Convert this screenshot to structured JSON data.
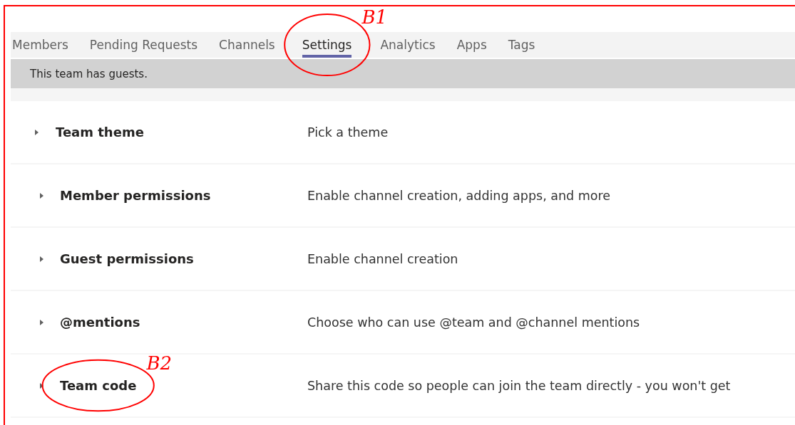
{
  "tabs": [
    {
      "label": "Members",
      "selected": false
    },
    {
      "label": "Pending Requests",
      "selected": false
    },
    {
      "label": "Channels",
      "selected": false
    },
    {
      "label": "Settings",
      "selected": true,
      "annotation": "B1"
    },
    {
      "label": "Analytics",
      "selected": false
    },
    {
      "label": "Apps",
      "selected": false
    },
    {
      "label": "Tags",
      "selected": false
    }
  ],
  "banner": "This team has guests.",
  "settings": [
    {
      "title": "Team theme",
      "description": "Pick a theme",
      "expanded": false
    },
    {
      "title": "Member permissions",
      "description": "Enable channel creation, adding apps, and more",
      "expanded": false
    },
    {
      "title": "Guest permissions",
      "description": "Enable channel creation",
      "expanded": false
    },
    {
      "title": "@mentions",
      "description": "Choose who can use @team and @channel mentions",
      "expanded": false
    },
    {
      "title": "Team code",
      "description": "Share this code so people can join the team directly - you won't get",
      "expanded": false,
      "annotation": "B2"
    }
  ]
}
